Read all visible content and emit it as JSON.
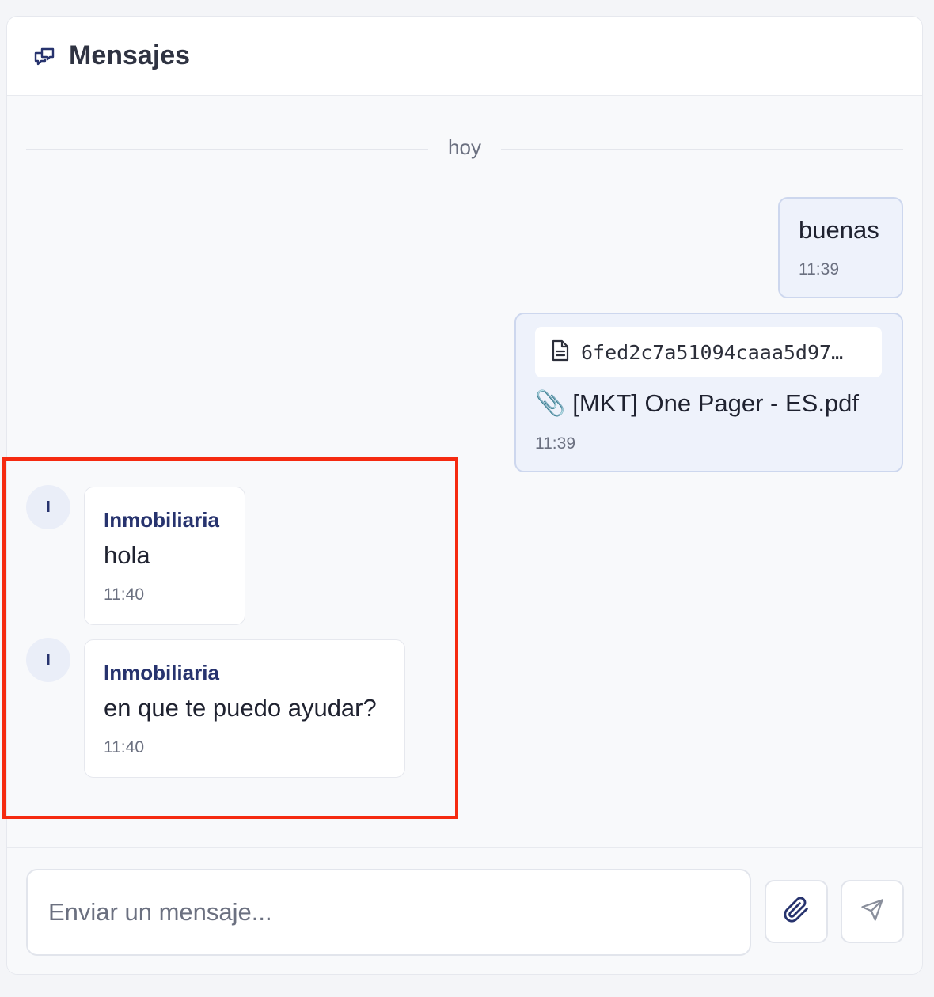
{
  "header": {
    "title": "Mensajes",
    "icon": "chat-bubbles-icon"
  },
  "day_separator": "hoy",
  "messages": [
    {
      "direction": "outgoing",
      "text": "buenas",
      "time": "11:39"
    },
    {
      "direction": "outgoing",
      "file_name": "6fed2c7a51094caaa5d97…",
      "attachment": "📎 [MKT] One Pager - ES.pdf",
      "time": "11:39"
    },
    {
      "direction": "incoming",
      "avatar": "I",
      "sender": "Inmobiliaria",
      "text": "hola",
      "time": "11:40"
    },
    {
      "direction": "incoming",
      "avatar": "I",
      "sender": "Inmobiliaria",
      "text": "en que te puedo ayudar?",
      "time": "11:40"
    }
  ],
  "composer": {
    "placeholder": "Enviar un mensaje..."
  },
  "colors": {
    "accent": "#27336e",
    "outgoing_bubble": "#eef2fb",
    "highlight": "#f52a10"
  }
}
